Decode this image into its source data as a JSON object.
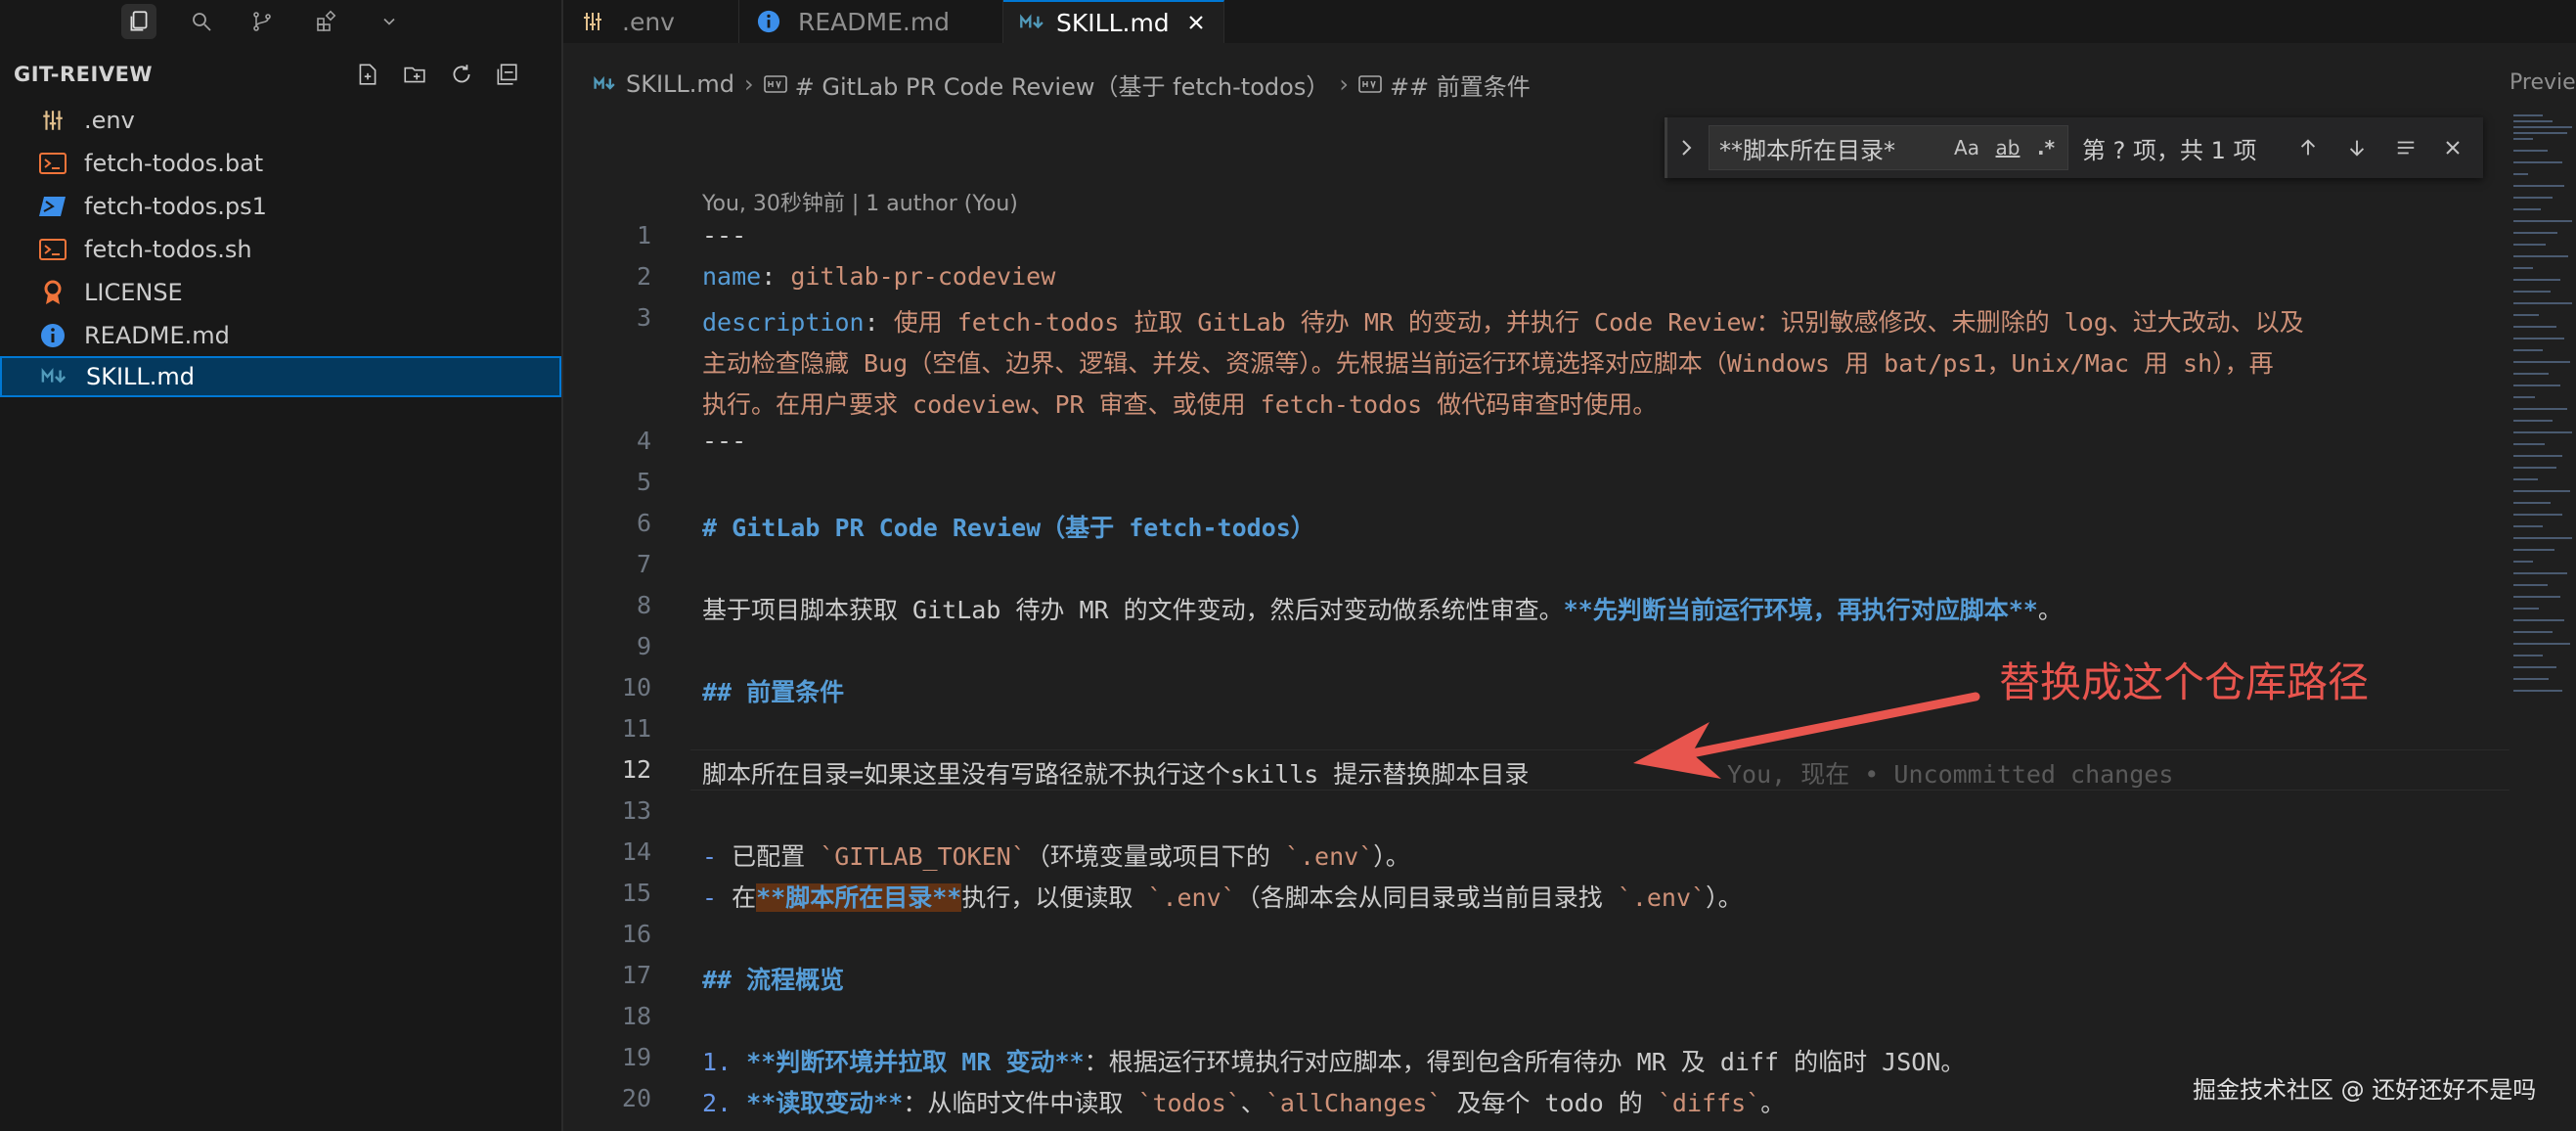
{
  "sidebar": {
    "title": "GIT-REIVEW",
    "files": [
      {
        "label": ".env",
        "icon": "settings-file-icon",
        "color": "#e2c08d"
      },
      {
        "label": "fetch-todos.bat",
        "icon": "terminal-file-icon",
        "color": "#f0743a"
      },
      {
        "label": "fetch-todos.ps1",
        "icon": "powershell-file-icon",
        "color": "#3b8eea"
      },
      {
        "label": "fetch-todos.sh",
        "icon": "terminal-file-icon",
        "color": "#f0743a"
      },
      {
        "label": "LICENSE",
        "icon": "license-file-icon",
        "color": "#f0743a"
      },
      {
        "label": "README.md",
        "icon": "info-file-icon",
        "color": "#3b8eea"
      },
      {
        "label": "SKILL.md",
        "icon": "markdown-file-icon",
        "color": "#519aba",
        "selected": true
      }
    ]
  },
  "tabs": [
    {
      "label": ".env",
      "icon": "settings-file-icon",
      "active": false
    },
    {
      "label": "README.md",
      "icon": "info-file-icon",
      "active": false
    },
    {
      "label": "SKILL.md",
      "icon": "markdown-file-icon",
      "active": true
    }
  ],
  "breadcrumb": {
    "file": "SKILL.md",
    "h1": "# GitLab PR Code Review（基于 fetch-todos）",
    "h2": "## 前置条件",
    "preview": "Previe"
  },
  "find": {
    "query": "**脚本所在目录*",
    "match_case": "Aa",
    "whole_word": "ab",
    "regex": ".*",
    "count": "第 ? 项，共 1 项"
  },
  "editor": {
    "blame_header": "You, 30秒钟前 | 1 author (You)",
    "current_line": 12,
    "ghost_text": "You, 现在 • Uncommitted changes",
    "line_numbers": [
      "1",
      "2",
      "3",
      "4",
      "5",
      "6",
      "7",
      "8",
      "9",
      "10",
      "11",
      "12",
      "13",
      "14",
      "15",
      "16",
      "17",
      "18",
      "19",
      "20"
    ],
    "l1": "---",
    "l2_key": "name",
    "l2_colon": ": ",
    "l2_val": "gitlab-pr-codeview",
    "l3_key": "description",
    "l3_colon": ": ",
    "l3_a": "使用 fetch-todos 拉取 GitLab 待办 MR 的变动，并执行 Code Review：识别敏感修改、未删除的 log、过大改动、以及",
    "l3_b": "主动检查隐藏 Bug（空值、边界、逻辑、并发、资源等）。先根据当前运行环境选择对应脚本（Windows 用 bat/ps1，Unix/Mac 用 sh），再",
    "l3_c": "执行。在用户要求 codeview、PR 审查、或使用 fetch-todos 做代码审查时使用。",
    "l4": "---",
    "l6": "# GitLab PR Code Review（基于 fetch-todos）",
    "l8_text": "基于项目脚本获取 GitLab 待办 MR 的文件变动，然后对变动做系统性审查。",
    "l8_bold": "**先判断当前运行环境，再执行对应脚本**",
    "l8_end": "。",
    "l10": "## 前置条件",
    "l12": "脚本所在目录=如果这里没有写路径就不执行这个skills 提示替换脚本目录",
    "l14_dash": "- ",
    "l14_a": "已配置 ",
    "l14_code1": "`GITLAB_TOKEN`",
    "l14_b": "（环境变量或项目下的 ",
    "l14_code2": "`.env`",
    "l14_c": "）。",
    "l15_dash": "- ",
    "l15_a": "在",
    "l15_bold": "**脚本所在目录**",
    "l15_b": "执行，以便读取 ",
    "l15_code1": "`.env`",
    "l15_c": "（各脚本会从同目录或当前目录找 ",
    "l15_code2": "`.env`",
    "l15_d": "）。",
    "l17": "## 流程概览",
    "l19_num": "1. ",
    "l19_bold": "**判断环境并拉取 MR 变动**",
    "l19_text": "：根据运行环境执行对应脚本，得到包含所有待办 MR 及 diff 的临时 JSON。",
    "l20_num": "2. ",
    "l20_bold": "**读取变动**",
    "l20_a": "：从临时文件中读取 ",
    "l20_code1": "`todos`",
    "l20_b": "、",
    "l20_code2": "`allChanges`",
    "l20_c": " 及每个 todo 的 ",
    "l20_code3": "`diffs`",
    "l20_d": "。"
  },
  "annotation": {
    "text": "替换成这个仓库路径",
    "color": "#e8554e"
  },
  "watermark": "掘金技术社区 @ 还好还好不是吗",
  "colors": {
    "accent": "#0078d4",
    "selection": "#04395e",
    "find_highlight": "#613214"
  }
}
